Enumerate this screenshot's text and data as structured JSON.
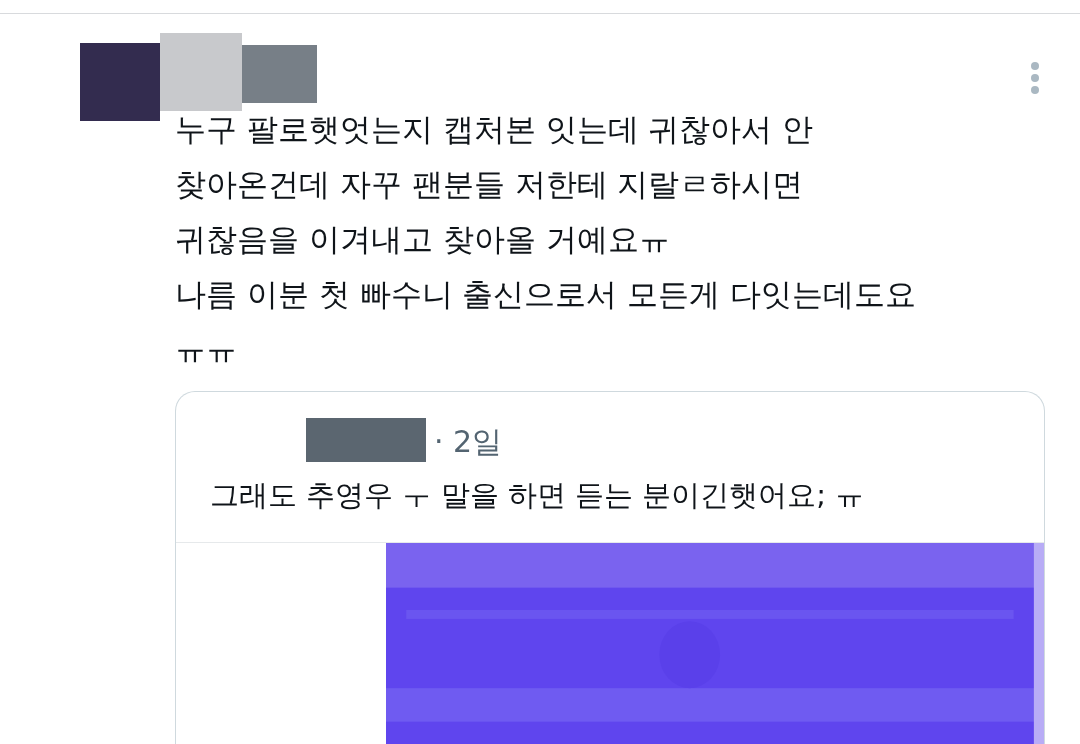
{
  "tweet": {
    "text": "누구 팔로햇엇는지 캡처본 잇는데 귀찮아서 안\n찾아온건데 자꾸 팬분들 저한테 지랄ㄹ하시면\n귀찮음을 이겨내고 찾아올 거예요ㅠ\n나름 이분 첫 빠수니 출신으로서 모든게 다잇는데도요\nㅠㅠ",
    "quote": {
      "time": "· 2일",
      "text": "그래도 추영우 ㅜ 말을 하면 듣는 분이긴햇어요; ㅠ"
    }
  }
}
